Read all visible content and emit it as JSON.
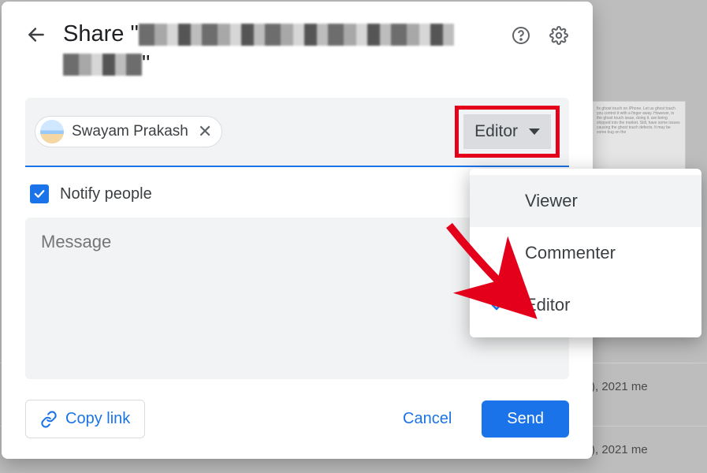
{
  "bg": {
    "row1": "), 2021 me",
    "row2": "), 2021 me",
    "thumb_text": "fix ghost touch on iPhone. Let us ghost touch you control it with a finger away. However, in the ghost touch issue, doing it. are being shipped into the market. Still, have some issues causing the ghost touch defects. It may be some bug on the"
  },
  "header": {
    "title_prefix": "Share \"",
    "title_suffix": "\""
  },
  "chip": {
    "name": "Swayam Prakash"
  },
  "role_button": {
    "label": "Editor"
  },
  "notify": {
    "label": "Notify people",
    "checked": true
  },
  "message": {
    "placeholder": "Message"
  },
  "footer": {
    "copy_link": "Copy link",
    "cancel": "Cancel",
    "send": "Send"
  },
  "dropdown": {
    "options": [
      "Viewer",
      "Commenter",
      "Editor"
    ],
    "selected": "Editor"
  }
}
